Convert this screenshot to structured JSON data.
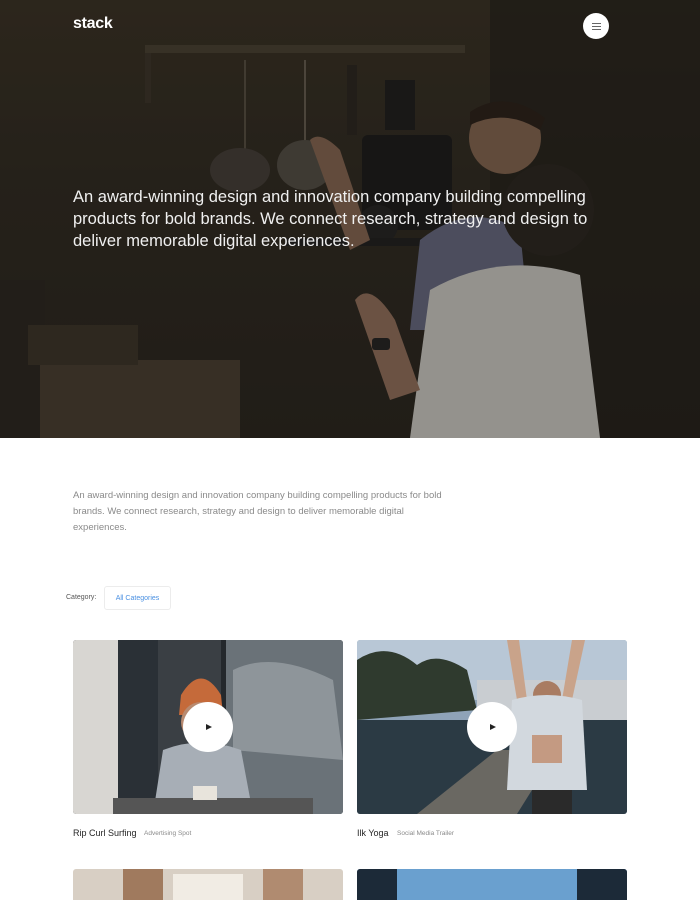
{
  "header": {
    "logo": "stack",
    "menu_icon": "hamburger-icon"
  },
  "hero": {
    "text": "An award-winning design and innovation company building compelling products for bold brands. We connect research, strategy and design to deliver memorable digital experiences."
  },
  "intro": {
    "text": "An award-winning design and innovation company building compelling products for bold brands. We connect research, strategy and design to deliver memorable digital experiences."
  },
  "filter": {
    "label": "Category:",
    "selected": "All Categories"
  },
  "cards": [
    {
      "title": "Rip Curl Surfing",
      "subtitle": "Advertising Spot"
    },
    {
      "title": "Ilk Yoga",
      "subtitle": "Social Media Trailer"
    }
  ],
  "colors": {
    "accent": "#4a90e2",
    "text": "#252525",
    "muted": "#8a8a8a"
  }
}
